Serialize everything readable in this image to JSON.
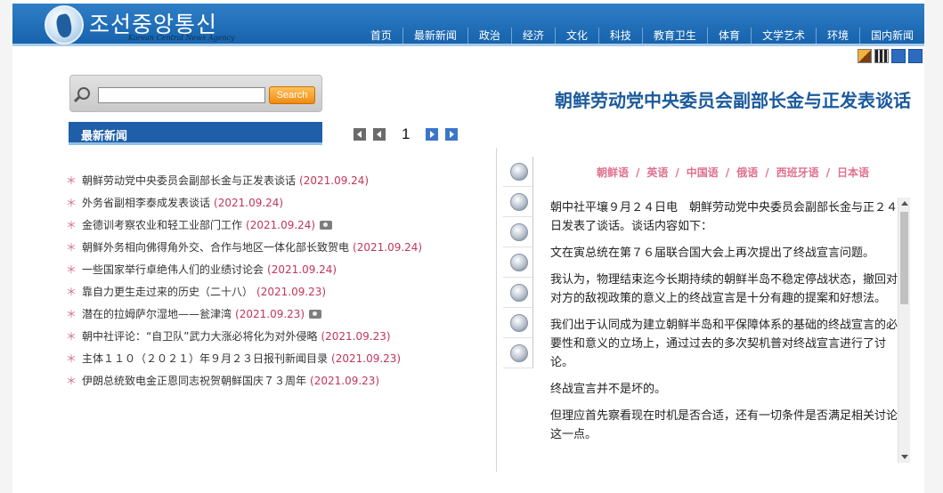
{
  "header": {
    "title": "조선중앙통신",
    "subtitle": "Korean Central News Agency",
    "nav": [
      "首页",
      "最新新闻",
      "政治",
      "经济",
      "文化",
      "科技",
      "教育卫生",
      "体育",
      "文学艺术",
      "环境",
      "国内新闻"
    ]
  },
  "search": {
    "value": "",
    "button_label": "Search"
  },
  "latest": {
    "heading": "最新新闻",
    "page": "1",
    "items": [
      {
        "title": "朝鲜劳动党中央委员会副部长金与正发表谈话",
        "date": "(2021.09.24)",
        "photo": false
      },
      {
        "title": "外务省副相李泰成发表谈话",
        "date": "(2021.09.24)",
        "photo": false
      },
      {
        "title": "金德训考察农业和轻工业部门工作",
        "date": "(2021.09.24)",
        "photo": true
      },
      {
        "title": "朝鲜外务相向佛得角外交、合作与地区一体化部长致贺电",
        "date": "(2021.09.24)",
        "photo": false
      },
      {
        "title": "一些国家举行卓绝伟人们的业绩讨论会",
        "date": "(2021.09.24)",
        "photo": false
      },
      {
        "title": "靠自力更生走过来的历史（二十八）",
        "date": "(2021.09.23)",
        "photo": false
      },
      {
        "title": "潜在的拉姆萨尔湿地——瓮津湾",
        "date": "(2021.09.23)",
        "photo": true
      },
      {
        "title": "朝中社评论：“自卫队”武力大涨必将化为对外侵略",
        "date": "(2021.09.23)",
        "photo": false
      },
      {
        "title": "主体１１０（２０２１）年９月２３日报刊新闻目录",
        "date": "(2021.09.23)",
        "photo": false
      },
      {
        "title": "伊朗总统致电金正恩同志祝贺朝鲜国庆７３周年",
        "date": "(2021.09.23)",
        "photo": false
      }
    ]
  },
  "article": {
    "title": "朝鲜劳动党中央委员会副部长金与正发表谈话",
    "languages": [
      "朝鲜语",
      "英语",
      "中国语",
      "俄语",
      "西班牙语",
      "日本语"
    ],
    "paragraphs": [
      "朝中社平壤９月２４日电　朝鲜劳动党中央委员会副部长金与正２４日发表了谈话。谈话内容如下：",
      "文在寅总统在第７６届联合国大会上再次提出了终战宣言问题。",
      "我认为，物理结束迄今长期持续的朝鲜半岛不稳定停战状态，撤回对对方的敌视政策的意义上的终战宣言是十分有趣的提案和好想法。",
      "我们出于认同成为建立朝鲜半岛和平保障体系的基础的终战宣言的必要性和意义的立场上，通过过去的多次契机普对终战宣言进行了讨论。",
      "终战宣言并不是坏的。",
      "但理应首先察看现在时机是否合适，还有一切条件是否满足相关讨论这一点。"
    ]
  },
  "icons": [
    "home-icon",
    "movie-icon",
    "scroll-up-icon",
    "scroll-down-icon"
  ],
  "colors": {
    "header_blue": "#1f6bb5",
    "title_blue": "#1b5a9c",
    "date_red": "#c0365a",
    "lang_pink": "#e0708e",
    "search_orange": "#f08a12"
  }
}
